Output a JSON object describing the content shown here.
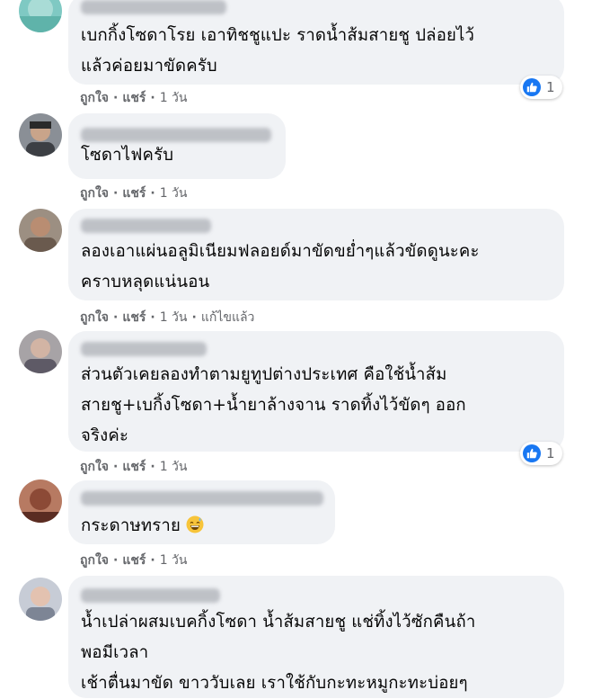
{
  "actions": {
    "like": "ถูกใจ",
    "reply": "แชร์",
    "separator": "·"
  },
  "colors": {
    "bubble": "#f0f2f5",
    "meta_text": "#65676b",
    "like_blue": "#1877f2"
  },
  "comments": [
    {
      "author": "",
      "text": "เบกกิ้งโซดาโรย เอาทิชชูแปะ ราดน้ำส้มสายชู ปล่อยไว้\nแล้วค่อยมาขัดครับ",
      "time": "1 วัน",
      "edited": "",
      "reactions": "1"
    },
    {
      "author": "",
      "text": "โซดาไฟครับ",
      "time": "1 วัน",
      "edited": "",
      "reactions": ""
    },
    {
      "author": "",
      "text": "ลองเอาแผ่นอลูมิเนียมฟลอยด์มาขัดขย่ำๆแล้วขัดดูนะคะ\nคราบหลุดแน่นอน",
      "time": "1 วัน",
      "edited": "แก้ไขแล้ว",
      "reactions": ""
    },
    {
      "author": "",
      "text": "ส่วนตัวเคยลองทำตามยูทูปต่างประเทศ คือใช้น้ำส้ม\nสายชู+เบกิ้งโซดา+น้ำยาล้างจาน ราดทิ้งไว้ขัดๆ ออก\nจริงค่ะ",
      "time": "1 วัน",
      "edited": "",
      "reactions": "1"
    },
    {
      "author": "",
      "text": "กระดาษทราย",
      "emoji": "grinning-sweat-emoji",
      "time": "1 วัน",
      "edited": "",
      "reactions": ""
    },
    {
      "author": "",
      "text": "น้ำเปล่าผสมเบคกิ้งโซดา น้ำส้มสายชู แช่ทิ้งไว้ซักคืนถ้า\nพอมีเวลา\nเช้าตื่นมาขัด ขาววับเลย เราใช้กับกะทะหมูกะทะบ่อยๆ",
      "time": "",
      "edited": "",
      "reactions": ""
    }
  ]
}
